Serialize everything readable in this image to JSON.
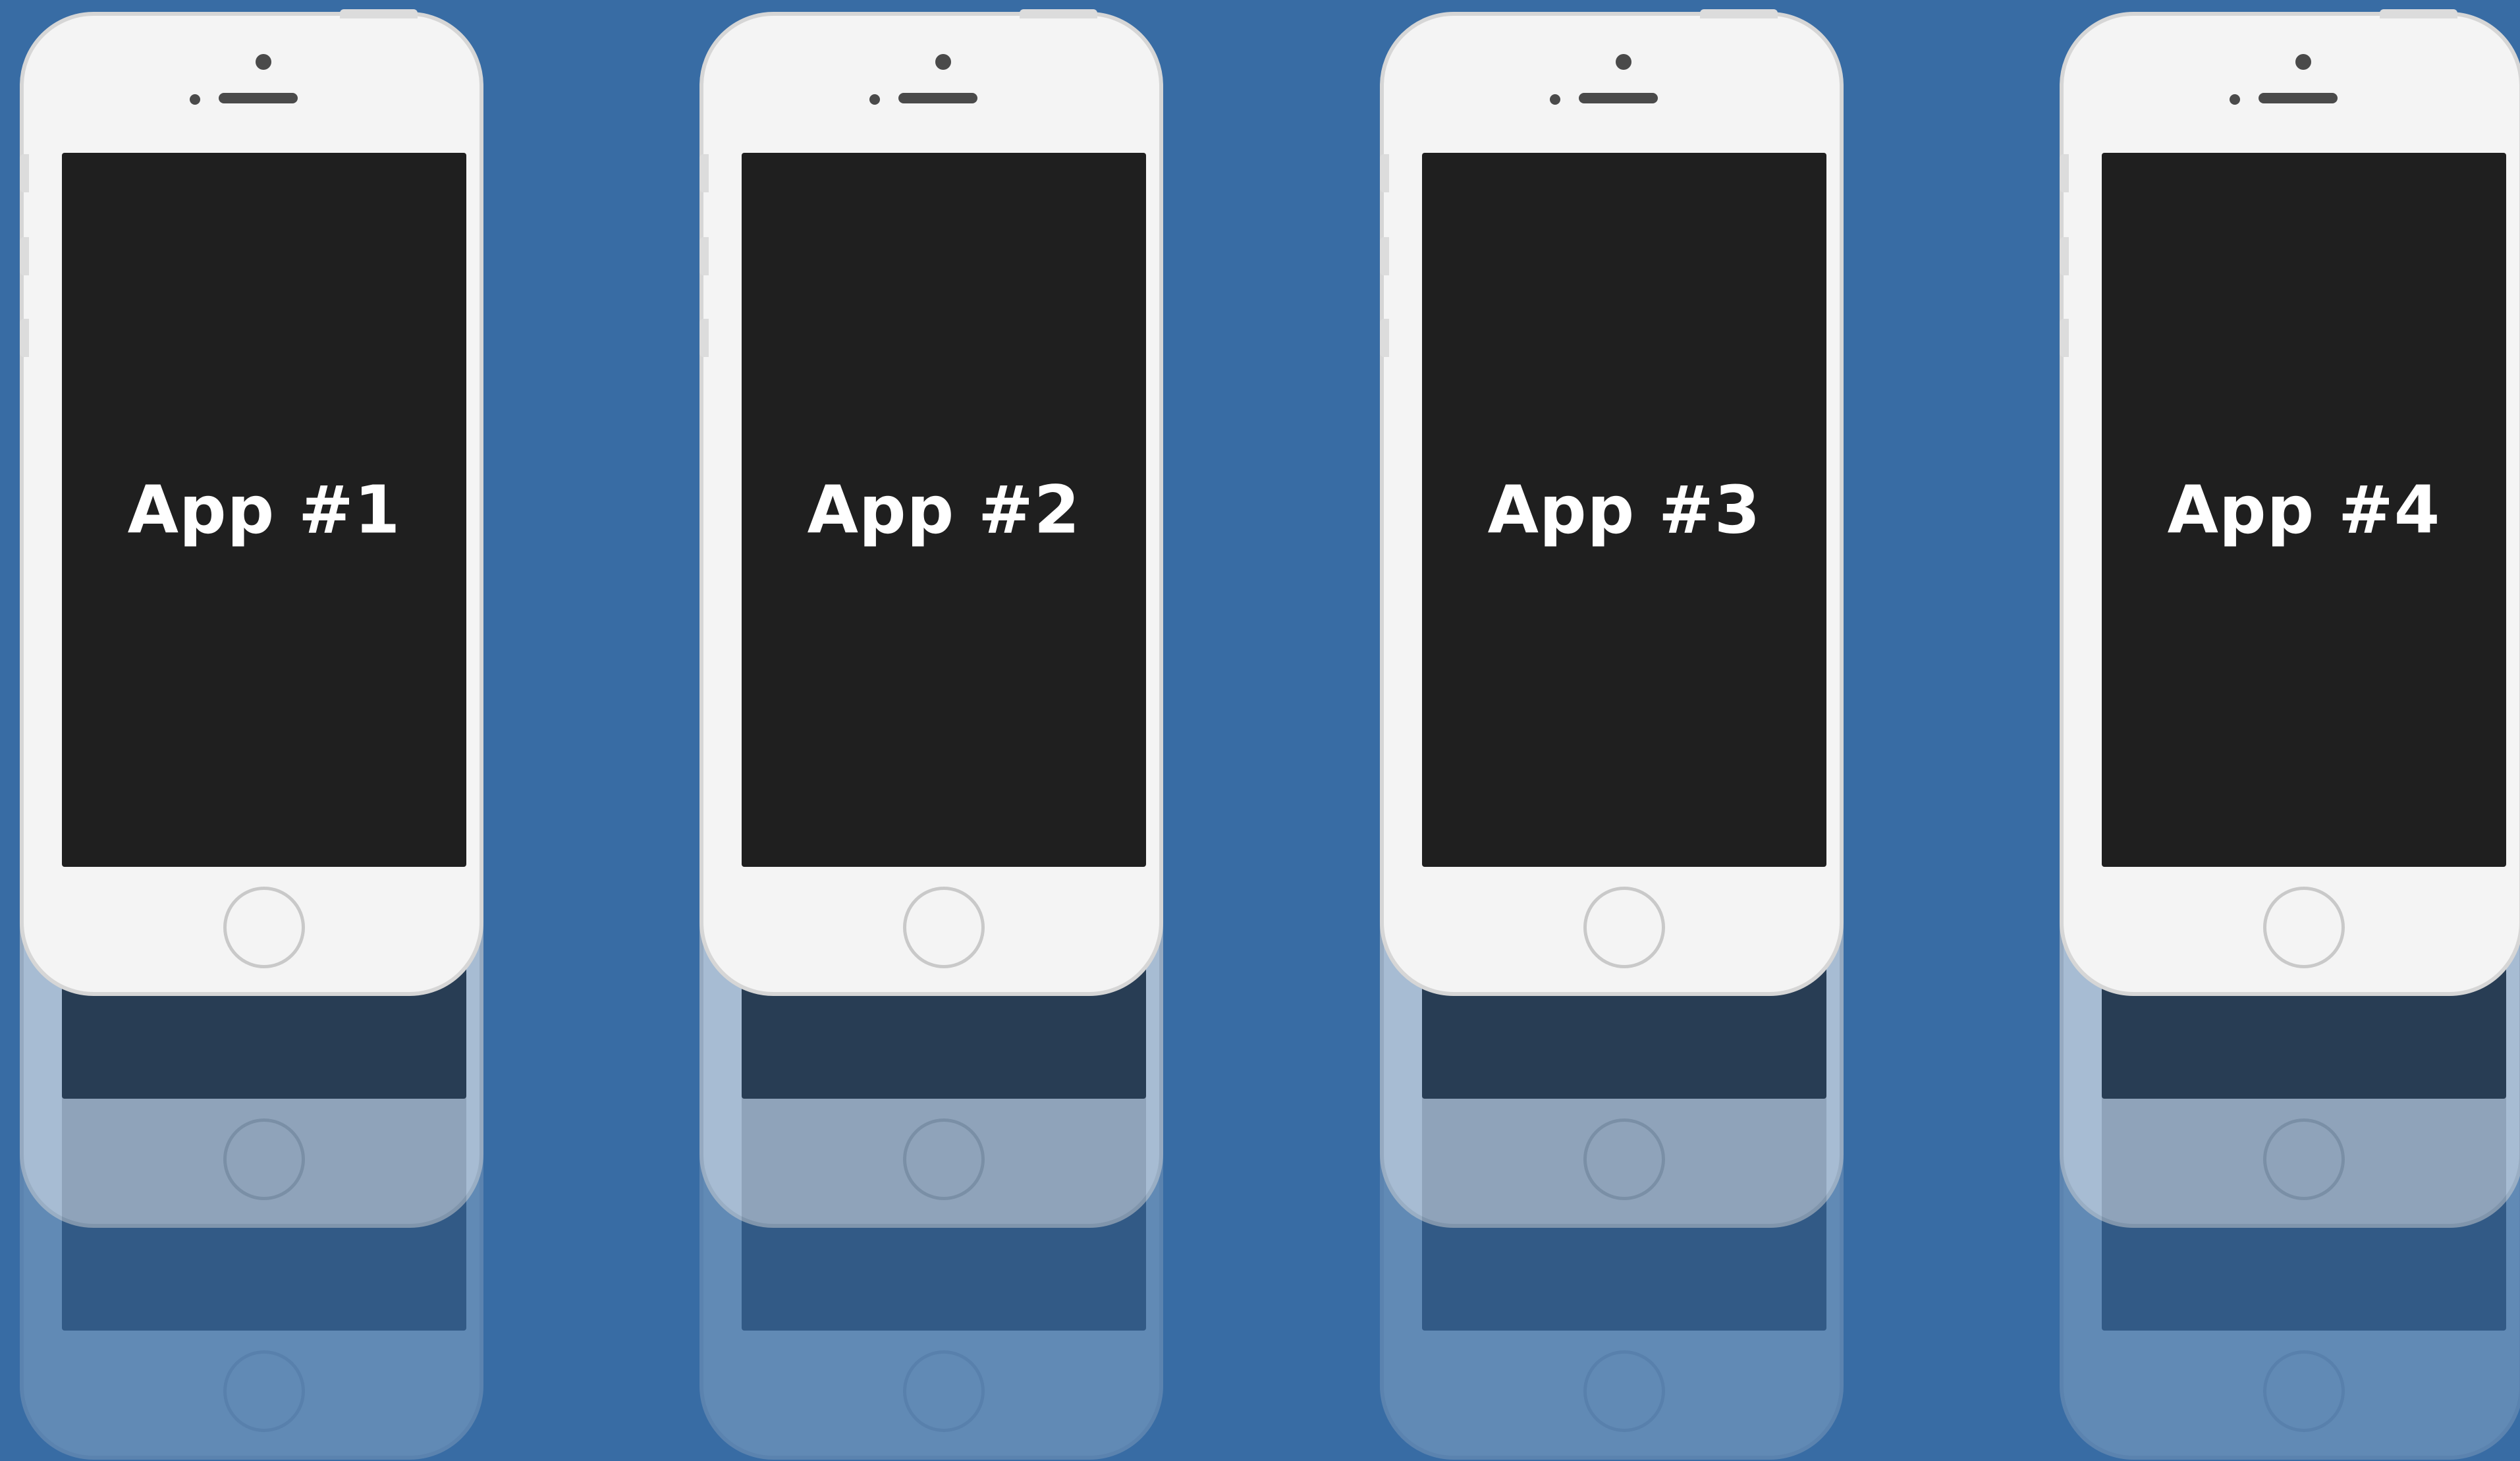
{
  "background_color": "#386ca4",
  "phones": [
    {
      "screen_label": "App #1"
    },
    {
      "screen_label": "App #2"
    },
    {
      "screen_label": "App #3"
    },
    {
      "screen_label": "App #4"
    }
  ]
}
